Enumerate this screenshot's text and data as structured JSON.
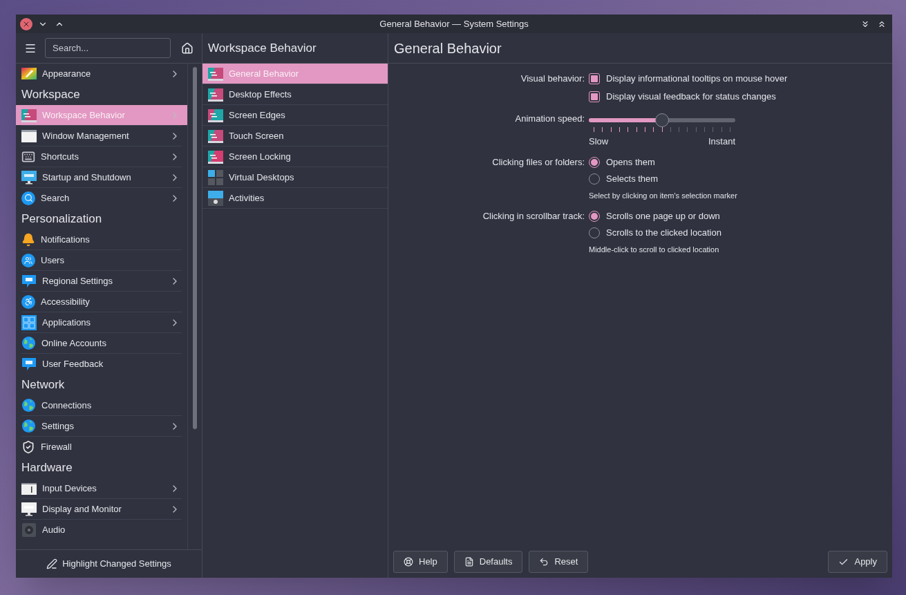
{
  "window": {
    "title": "General Behavior — System Settings"
  },
  "sidebar": {
    "search": {
      "placeholder": "Search..."
    },
    "sections": [
      {
        "items": [
          {
            "label": "Appearance",
            "has_submenu": true,
            "selected": false
          }
        ]
      },
      {
        "heading": "Workspace",
        "items": [
          {
            "label": "Workspace Behavior",
            "has_submenu": true,
            "selected": true
          },
          {
            "label": "Window Management",
            "has_submenu": true,
            "selected": false
          },
          {
            "label": "Shortcuts",
            "has_submenu": true,
            "selected": false
          },
          {
            "label": "Startup and Shutdown",
            "has_submenu": true,
            "selected": false
          },
          {
            "label": "Search",
            "has_submenu": true,
            "selected": false
          }
        ]
      },
      {
        "heading": "Personalization",
        "items": [
          {
            "label": "Notifications",
            "has_submenu": false,
            "selected": false
          },
          {
            "label": "Users",
            "has_submenu": false,
            "selected": false
          },
          {
            "label": "Regional Settings",
            "has_submenu": true,
            "selected": false
          },
          {
            "label": "Accessibility",
            "has_submenu": false,
            "selected": false
          },
          {
            "label": "Applications",
            "has_submenu": true,
            "selected": false
          },
          {
            "label": "Online Accounts",
            "has_submenu": false,
            "selected": false
          },
          {
            "label": "User Feedback",
            "has_submenu": false,
            "selected": false
          }
        ]
      },
      {
        "heading": "Network",
        "items": [
          {
            "label": "Connections",
            "has_submenu": false,
            "selected": false
          },
          {
            "label": "Settings",
            "has_submenu": true,
            "selected": false
          },
          {
            "label": "Firewall",
            "has_submenu": false,
            "selected": false
          }
        ]
      },
      {
        "heading": "Hardware",
        "items": [
          {
            "label": "Input Devices",
            "has_submenu": true,
            "selected": false
          },
          {
            "label": "Display and Monitor",
            "has_submenu": true,
            "selected": false
          },
          {
            "label": "Audio",
            "has_submenu": false,
            "selected": false
          }
        ]
      }
    ],
    "footer_button": "Highlight Changed Settings"
  },
  "category": {
    "title": "Workspace Behavior",
    "items": [
      {
        "label": "General Behavior",
        "selected": true
      },
      {
        "label": "Desktop Effects",
        "selected": false
      },
      {
        "label": "Screen Edges",
        "selected": false
      },
      {
        "label": "Touch Screen",
        "selected": false
      },
      {
        "label": "Screen Locking",
        "selected": false
      },
      {
        "label": "Virtual Desktops",
        "selected": false
      },
      {
        "label": "Activities",
        "selected": false
      }
    ]
  },
  "page": {
    "title": "General Behavior",
    "settings": [
      {
        "kind": "checkboxes",
        "label": "Visual behavior:",
        "options": [
          {
            "text": "Display informational tooltips on mouse hover",
            "checked": true
          },
          {
            "text": "Display visual feedback for status changes",
            "checked": true
          }
        ]
      },
      {
        "kind": "slider",
        "label": "Animation speed:",
        "level": 0.5,
        "min_label": "Slow",
        "max_label": "Instant"
      },
      {
        "kind": "radios",
        "label": "Clicking files or folders:",
        "options": [
          {
            "text": "Opens them",
            "selected": true
          },
          {
            "text": "Selects them",
            "selected": false
          }
        ],
        "note": "Select by clicking on item's selection marker"
      },
      {
        "kind": "radios",
        "label": "Clicking in scrollbar track:",
        "options": [
          {
            "text": "Scrolls one page up or down",
            "selected": true
          },
          {
            "text": "Scrolls to the clicked location",
            "selected": false
          }
        ],
        "note": "Middle-click to scroll to clicked location"
      }
    ],
    "buttons": [
      "Help",
      "Defaults",
      "Reset"
    ],
    "apply_button": "Apply"
  }
}
